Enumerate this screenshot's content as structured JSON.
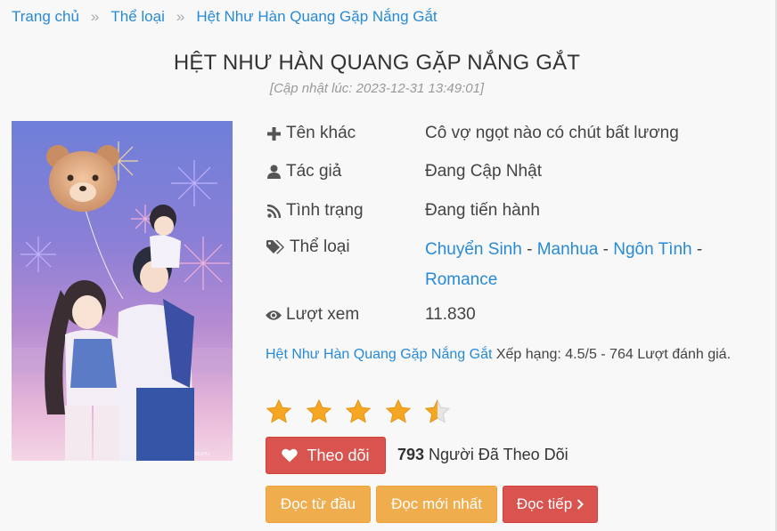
{
  "breadcrumb": {
    "home": "Trang chủ",
    "category": "Thể loại",
    "current": "Hệt Như Hàn Quang Gặp Nắng Gắt",
    "separator": "»"
  },
  "title": "HỆT NHƯ HÀN QUANG GẶP NẮNG GẮT",
  "updated": "[Cập nhật lúc: 2023-12-31 13:49:01]",
  "cover": {
    "alt_icon": "manga-cover-image"
  },
  "info": {
    "other_name": {
      "icon": "plus-icon",
      "label": "Tên khác",
      "value": "Cô vợ ngọt nào có chút bất lương"
    },
    "author": {
      "icon": "user-icon",
      "label": "Tác giả",
      "value": "Đang Cập Nhật"
    },
    "status": {
      "icon": "rss-icon",
      "label": "Tình trạng",
      "value": "Đang tiến hành"
    },
    "genres": {
      "icon": "tags-icon",
      "label": "Thể loại",
      "items": [
        "Chuyển Sinh",
        "Manhua",
        "Ngôn Tình",
        "Romance"
      ],
      "sep": "-"
    },
    "views": {
      "icon": "eye-icon",
      "label": "Lượt xem",
      "value": "11.830"
    }
  },
  "rating": {
    "title_link": "Hệt Như Hàn Quang Gặp Nắng Gắt",
    "text": " Xếp hạng: 4.5/5 - 764 Lượt đánh giá.",
    "value": 4.5,
    "max": 5,
    "star_color": "#f5a623"
  },
  "follow": {
    "button_label": "Theo dõi",
    "count": "793",
    "count_text": " Người Đã Theo Dõi"
  },
  "actions": {
    "read_first": "Đọc từ đầu",
    "read_latest": "Đọc mới nhất",
    "read_continue": "Đọc tiếp",
    "continue_icon": "chevron-right-icon"
  },
  "colors": {
    "link": "#288ad6",
    "danger": "#d9534f",
    "warning": "#f0ad4e"
  }
}
